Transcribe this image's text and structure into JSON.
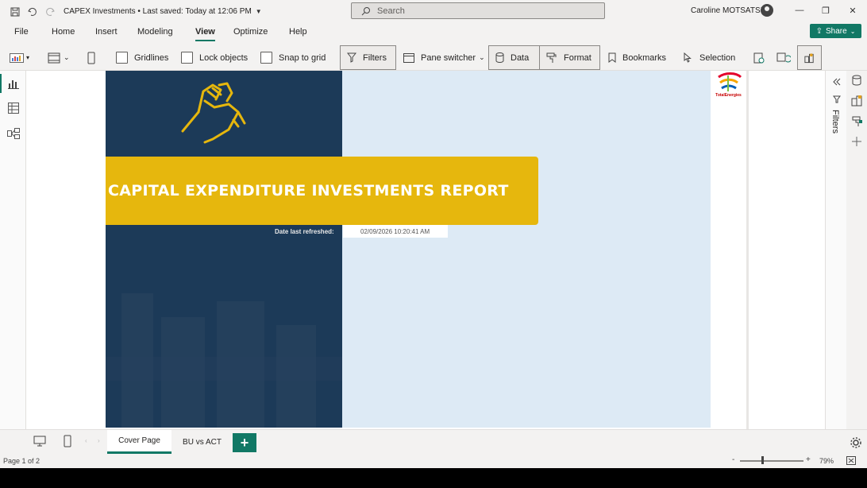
{
  "window": {
    "title": "CAPEX Investments • Last saved: Today at 12:06 PM",
    "search_placeholder": "Search",
    "user_name": "Caroline MOTSATSI"
  },
  "menu": {
    "items": [
      "File",
      "Home",
      "Insert",
      "Modeling",
      "View",
      "Optimize",
      "Help"
    ],
    "active": "View",
    "share_label": "Share"
  },
  "ribbon": {
    "gridlines": "Gridlines",
    "lock_objects": "Lock objects",
    "snap_to_grid": "Snap to grid",
    "filters": "Filters",
    "pane_switcher": "Pane switcher",
    "data": "Data",
    "format": "Format",
    "bookmarks": "Bookmarks",
    "selection": "Selection"
  },
  "report": {
    "title": "CAPITAL EXPENDITURE INVESTMENTS REPORT",
    "refresh_label": "Date last refreshed:",
    "refresh_value": "02/09/2026 10:20:41 AM",
    "logo_text": "TotalEnergies"
  },
  "right_pane": {
    "filters_label": "Filters"
  },
  "tabs": {
    "items": [
      "Cover Page",
      "BU vs ACT"
    ],
    "active": "Cover Page"
  },
  "status": {
    "page_info": "Page 1 of 2",
    "zoom": "79%"
  },
  "colors": {
    "accent": "#117865",
    "banner": "#e6b70d",
    "navy": "#1c3a58",
    "page_bg": "#ddeaf5"
  }
}
